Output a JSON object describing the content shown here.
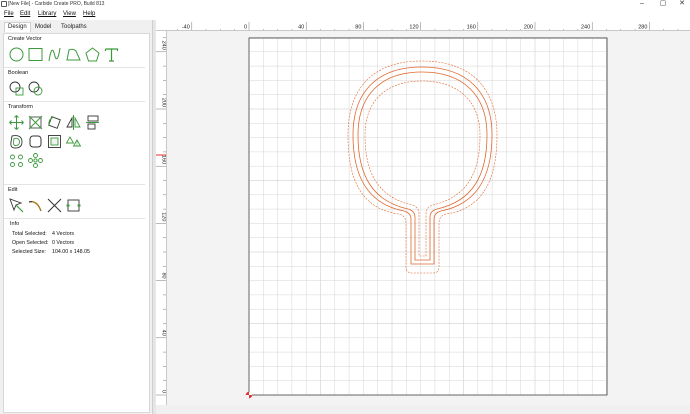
{
  "window": {
    "title": "[New File] - Carbide Create PRO, Build 813",
    "minimize_glyph": "–",
    "maximize_glyph": "▢",
    "close_glyph": "✕"
  },
  "menu": {
    "items": [
      {
        "label": "File"
      },
      {
        "label": "Edit"
      },
      {
        "label": "Library"
      },
      {
        "label": "View"
      },
      {
        "label": "Help"
      }
    ]
  },
  "tabs": [
    {
      "label": "Design",
      "active": true
    },
    {
      "label": "Model",
      "active": false
    },
    {
      "label": "Toolpaths",
      "active": false
    }
  ],
  "sections": {
    "create_vector": {
      "title": "Create Vector",
      "tools": [
        "circle-tool-icon",
        "rectangle-tool-icon",
        "curve-tool-icon",
        "polyline-tool-icon",
        "polygon-tool-icon",
        "text-tool-icon"
      ]
    },
    "boolean": {
      "title": "Boolean",
      "tools": [
        "union-tool-icon",
        "subtract-tool-icon"
      ]
    },
    "transform": {
      "title": "Transform",
      "tools": [
        "move-tool-icon",
        "scale-tool-icon",
        "rotate-tool-icon",
        "mirror-tool-icon",
        "align-tool-icon",
        "offset-tool-icon",
        "fillet-tool-icon",
        "inset-tool-icon",
        "array-tool-icon",
        "group-tool-icon",
        "ungroup-tool-icon",
        "circular-array-tool-icon"
      ]
    },
    "edit": {
      "title": "Edit",
      "tools": [
        "node-edit-tool-icon",
        "trim-tool-icon",
        "cut-tool-icon",
        "join-tool-icon"
      ]
    },
    "info": {
      "title": "Info",
      "rows": [
        {
          "label": "Total Selected:",
          "value": "4 Vectors"
        },
        {
          "label": "Open Selected:",
          "value": "0 Vectors"
        },
        {
          "label": "Selected Size:",
          "value": "104.00 x 148.05"
        }
      ]
    }
  },
  "rulers": {
    "h_ticks": [
      "-40",
      "0",
      "40",
      "80",
      "120",
      "160",
      "200",
      "240",
      "280"
    ],
    "v_ticks": [
      "240",
      "200",
      "160",
      "120",
      "80",
      "40",
      "0"
    ]
  },
  "colors": {
    "accent_green": "#3c9a3c",
    "vector_orange": "#e0662c",
    "grid_line": "#d6d6d6",
    "grid_major": "#c6c6c6",
    "stock_border": "#555555",
    "ruler_marker": "#e03030"
  }
}
